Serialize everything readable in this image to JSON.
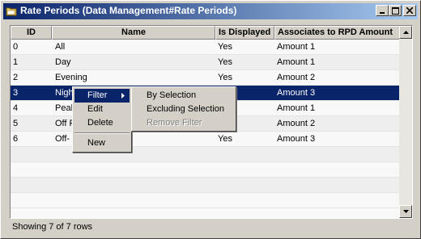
{
  "window": {
    "title": "Rate Periods (Data Management#Rate Periods)"
  },
  "grid": {
    "columns": [
      "ID",
      "Name",
      "Is Displayed",
      "Associates to RPD Amount"
    ],
    "rows": [
      {
        "id": "0",
        "name": "All",
        "displayed": "Yes",
        "amount": "Amount 1"
      },
      {
        "id": "1",
        "name": "Day",
        "displayed": "Yes",
        "amount": "Amount 1"
      },
      {
        "id": "2",
        "name": "Evening",
        "displayed": "Yes",
        "amount": "Amount 2"
      },
      {
        "id": "3",
        "name": "Nigh",
        "displayed": "",
        "amount": "Amount 3"
      },
      {
        "id": "4",
        "name": "Peak",
        "displayed": "",
        "amount": "Amount 1"
      },
      {
        "id": "5",
        "name": "Off P",
        "displayed": "",
        "amount": "Amount 2"
      },
      {
        "id": "6",
        "name": "Off-",
        "displayed": "Yes",
        "amount": "Amount 3"
      }
    ]
  },
  "context_menu": {
    "items": [
      "Filter",
      "Edit",
      "Delete",
      "New"
    ]
  },
  "filter_submenu": {
    "items": [
      "By Selection",
      "Excluding Selection",
      "Remove Filter"
    ]
  },
  "status": {
    "text": "Showing 7 of 7 rows"
  },
  "colors": {
    "selection": "#0a246a",
    "titlebar_start": "#0a246a",
    "titlebar_end": "#a6caf0"
  }
}
